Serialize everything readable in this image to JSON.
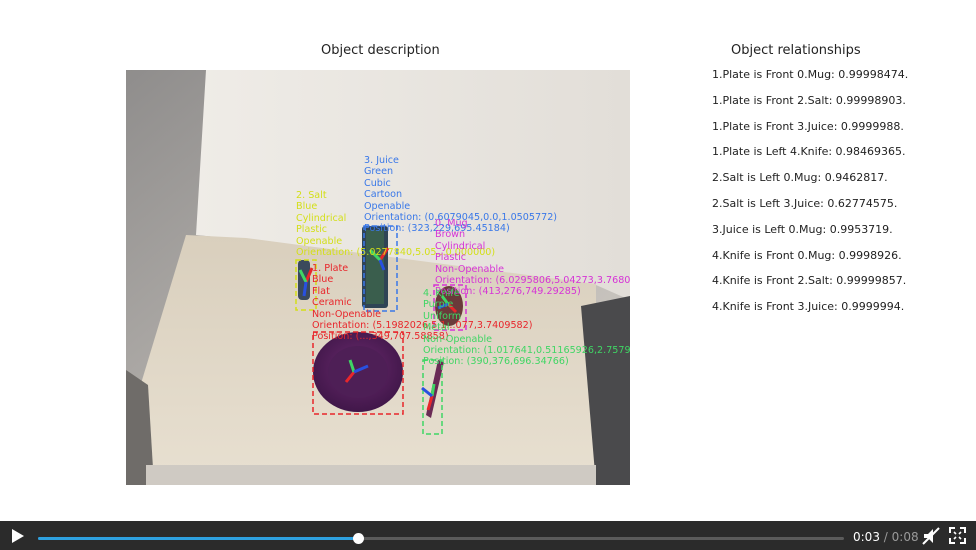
{
  "figure": {
    "left_title": "Object description",
    "right_title": "Object relationships"
  },
  "relationships": [
    "1.Plate is Front 0.Mug: 0.99998474.",
    "1.Plate is Front 2.Salt: 0.99998903.",
    "1.Plate is Front 3.Juice: 0.9999988.",
    "1.Plate is Left 4.Knife: 0.98469365.",
    "2.Salt is Left 0.Mug: 0.9462817.",
    "2.Salt is Left 3.Juice: 0.62774575.",
    "3.Juice is Left 0.Mug: 0.9953719.",
    "4.Knife is Front 0.Mug: 0.9998926.",
    "4.Knife is Front 2.Salt: 0.99999857.",
    "4.Knife is Front 3.Juice: 0.9999994."
  ],
  "annotations": {
    "juice": {
      "color": "#3a78e8",
      "lines": [
        "3. Juice",
        "Green",
        "Cubic",
        "Cartoon",
        "Openable",
        "Orientation: (0.6079045,0.0,1.0505772)",
        "Position: (323,229,695.45184)"
      ]
    },
    "salt": {
      "color": "#d3df18",
      "lines": [
        "2. Salt",
        "Blue",
        "Cylindrical",
        "Plastic",
        "Openable",
        "Orientation: (5.0277840,5.05...0.000000)"
      ]
    },
    "mug": {
      "color": "#d633d6",
      "lines": [
        "0. Mug",
        "Brown",
        "Cylindrical",
        "Plastic",
        "Non-Openable",
        "Orientation: (6.0295806,5.04273,3.768072)",
        "Position: (413,276,749.29285)"
      ]
    },
    "plate": {
      "color": "#e8262b",
      "lines": [
        "1. Plate",
        "Blue",
        "Flat",
        "Ceramic",
        "Non-Openable",
        "Orientation: (5.1982026,5.1...077,3.7409582)",
        "Position: (...,349,707.58858)"
      ]
    },
    "knife": {
      "color": "#3fd664",
      "lines": [
        "4. Knife",
        "Purple",
        "Uniform",
        "Metal",
        "Non-Openable",
        "Orientation: (1.017641,0.51165926,2.7579162)",
        "Position: (390,376,696.34766)"
      ]
    }
  },
  "player": {
    "current_time": "0:03",
    "separator": "/",
    "duration": "0:08",
    "progress": 0.397,
    "play_icon": "play-icon",
    "mute_icon": "muted-speaker-icon",
    "fullscreen_icon": "fullscreen-icon"
  }
}
